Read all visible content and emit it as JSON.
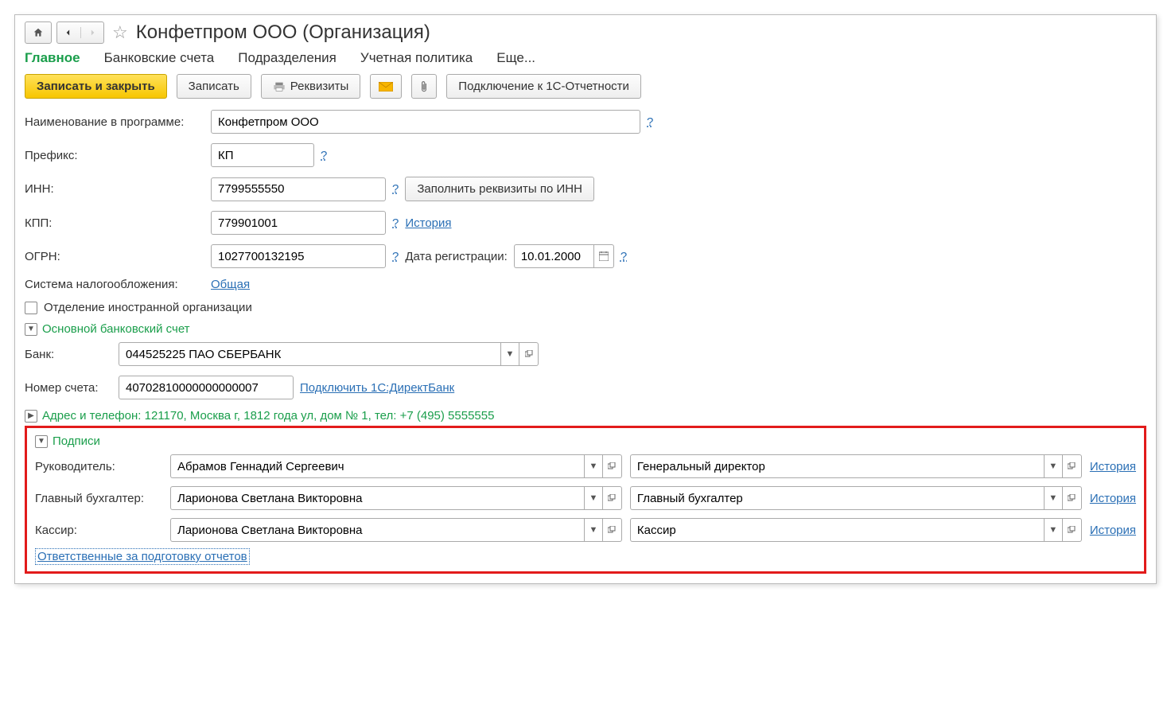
{
  "header": {
    "title": "Конфетпром ООО (Организация)"
  },
  "tabs": {
    "main": "Главное",
    "bank": "Банковские счета",
    "subdiv": "Подразделения",
    "policy": "Учетная политика",
    "more": "Еще..."
  },
  "toolbar": {
    "save_close": "Записать и закрыть",
    "save": "Записать",
    "requisites": "Реквизиты",
    "connect": "Подключение к 1С-Отчетности"
  },
  "form": {
    "name_label": "Наименование в программе:",
    "name_value": "Конфетпром ООО",
    "prefix_label": "Префикс:",
    "prefix_value": "КП",
    "inn_label": "ИНН:",
    "inn_value": "7799555550",
    "fill_by_inn": "Заполнить реквизиты по ИНН",
    "kpp_label": "КПП:",
    "kpp_value": "779901001",
    "history": "История",
    "ogrn_label": "ОГРН:",
    "ogrn_value": "1027700132195",
    "regdate_label": "Дата регистрации:",
    "regdate_value": "10.01.2000",
    "tax_label": "Система налогообложения:",
    "tax_value": "Общая",
    "foreign_label": "Отделение иностранной организации"
  },
  "bank_section": {
    "title": "Основной банковский счет",
    "bank_label": "Банк:",
    "bank_value": "044525225 ПАО СБЕРБАНК",
    "account_label": "Номер счета:",
    "account_value": "40702810000000000007",
    "directbank": "Подключить 1С:ДиректБанк"
  },
  "address_section": {
    "text": "Адрес и телефон: 121170, Москва г, 1812 года ул, дом № 1, тел: +7 (495) 5555555"
  },
  "signatures": {
    "title": "Подписи",
    "head_label": "Руководитель:",
    "head_person": "Абрамов Геннадий Сергеевич",
    "head_pos": "Генеральный директор",
    "chief_label": "Главный бухгалтер:",
    "chief_person": "Ларионова Светлана Викторовна",
    "chief_pos": "Главный бухгалтер",
    "cashier_label": "Кассир:",
    "cashier_person": "Ларионова Светлана Викторовна",
    "cashier_pos": "Кассир",
    "history": "История",
    "responsible": "Ответственные за подготовку отчетов"
  },
  "help_char": "?"
}
